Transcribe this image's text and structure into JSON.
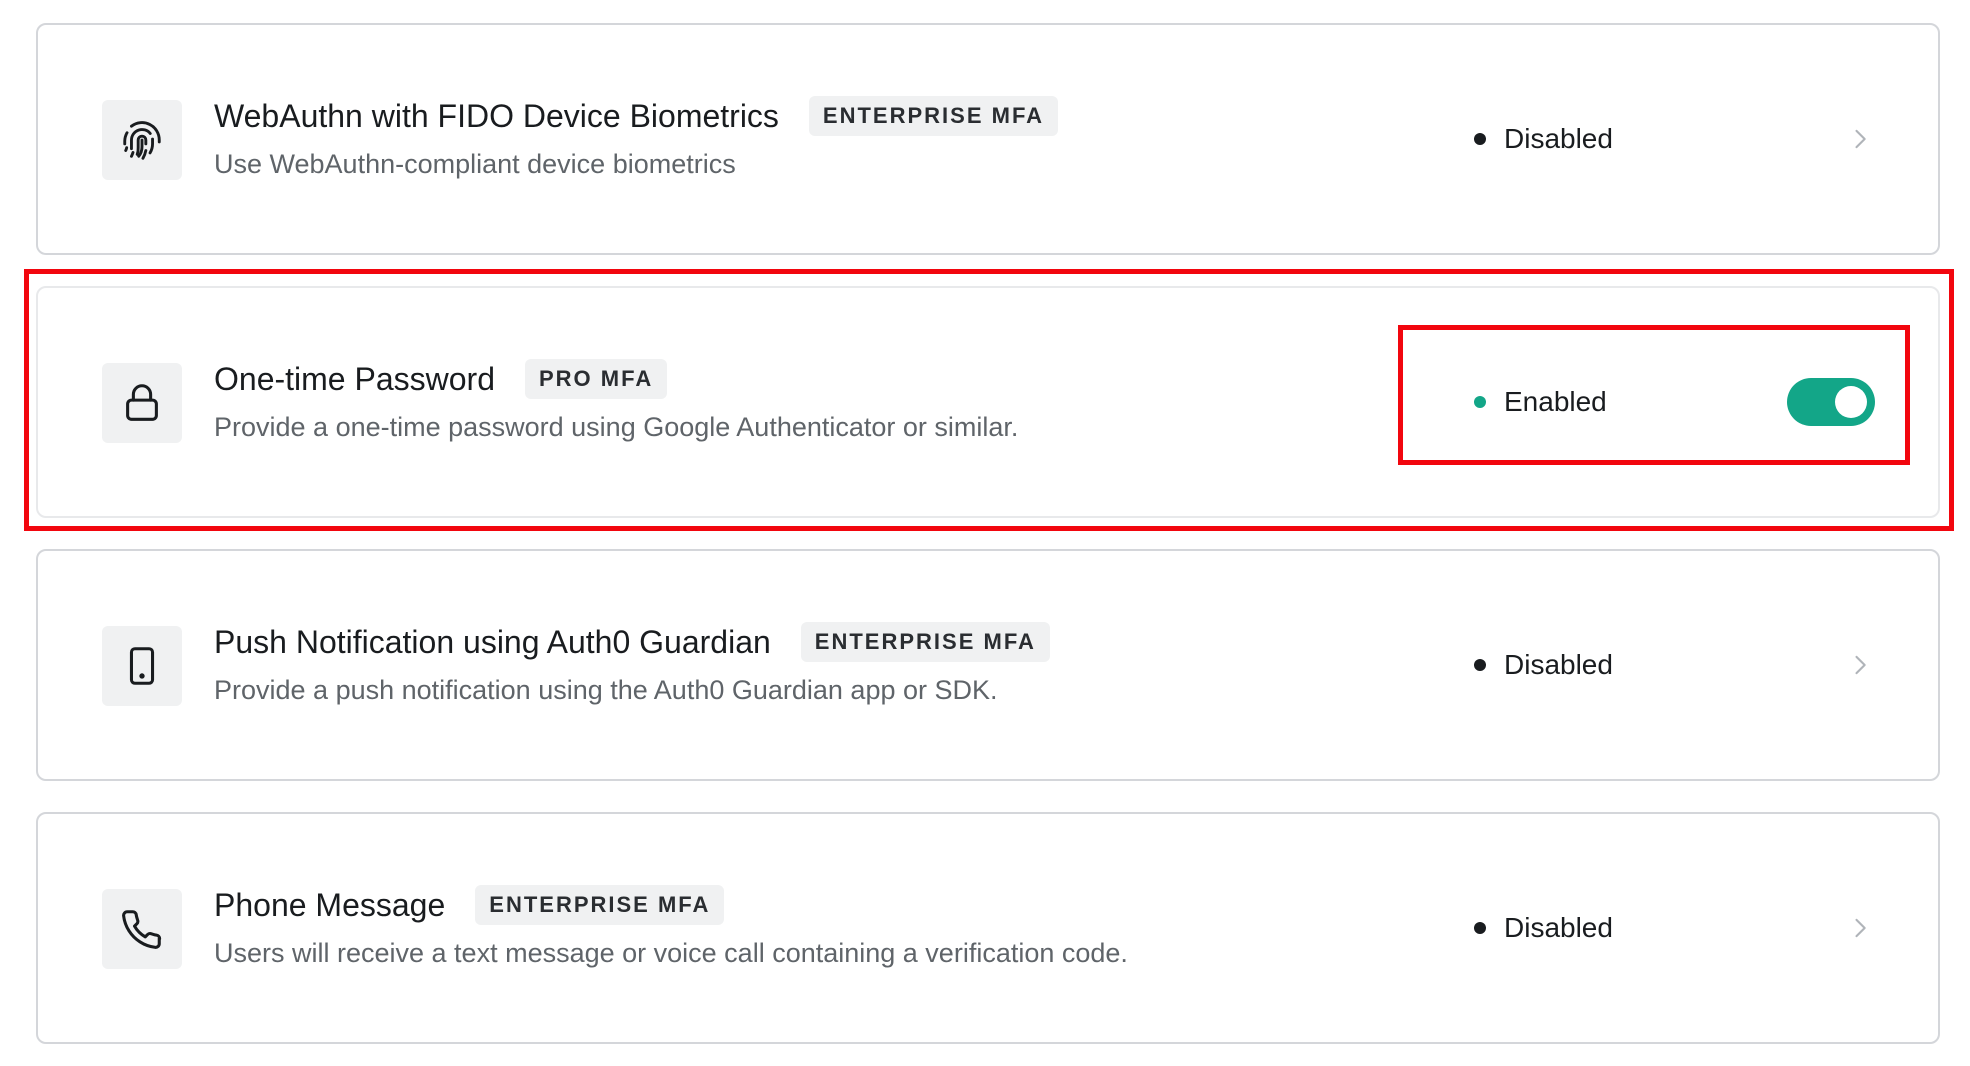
{
  "factors": [
    {
      "icon": "fingerprint-icon",
      "title": "WebAuthn with FIDO Device Biometrics",
      "tag": "ENTERPRISE MFA",
      "description": "Use WebAuthn-compliant device biometrics",
      "status": "Disabled"
    },
    {
      "icon": "lock-icon",
      "title": "One-time Password",
      "tag": "PRO MFA",
      "description": "Provide a one-time password using Google Authenticator or similar.",
      "status": "Enabled",
      "toggle_on": true
    },
    {
      "icon": "mobile-device-icon",
      "title": "Push Notification using Auth0 Guardian",
      "tag": "ENTERPRISE MFA",
      "description": "Provide a push notification using the Auth0 Guardian app or SDK.",
      "status": "Disabled"
    },
    {
      "icon": "phone-icon",
      "title": "Phone Message",
      "tag": "ENTERPRISE MFA",
      "description": "Users will receive a text message or voice call containing a verification code.",
      "status": "Disabled"
    }
  ],
  "colors": {
    "enabled": "#13a688",
    "highlight": "#f2060e"
  }
}
